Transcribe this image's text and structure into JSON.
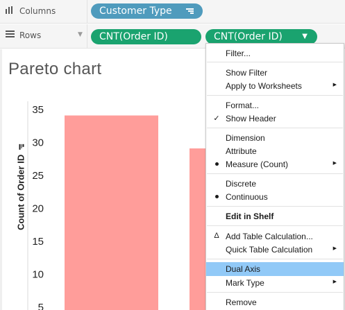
{
  "shelves": {
    "columns": {
      "label": "Columns",
      "icon": "columns-bars-icon",
      "pills": [
        "Customer Type"
      ]
    },
    "rows": {
      "label": "Rows",
      "icon": "rows-lines-icon",
      "pills": [
        "CNT(Order ID)",
        "CNT(Order ID)"
      ]
    }
  },
  "sheet": {
    "title": "Pareto chart"
  },
  "chart_data": {
    "type": "bar",
    "ylabel": "Count of Order ID",
    "ylim": [
      5,
      35
    ],
    "yticks": [
      35,
      30,
      25,
      20,
      15,
      10,
      5
    ],
    "values": [
      34,
      29
    ],
    "bar_color": "#ff9d9a"
  },
  "menu": {
    "items": {
      "filter": "Filter...",
      "show_filter": "Show Filter",
      "apply_worksheets": "Apply to Worksheets",
      "format": "Format...",
      "show_header": "Show Header",
      "dimension": "Dimension",
      "attribute": "Attribute",
      "measure_count": "Measure (Count)",
      "discrete": "Discrete",
      "continuous": "Continuous",
      "edit_in_shelf": "Edit in Shelf",
      "add_table_calc": "Add Table Calculation...",
      "quick_table_calc": "Quick Table Calculation",
      "dual_axis": "Dual Axis",
      "mark_type": "Mark Type",
      "remove": "Remove"
    },
    "marks": {
      "show_header_check": "✓",
      "delta": "Δ"
    },
    "highlight_color": "#91c9f7"
  },
  "colors": {
    "dimension_pill": "#4f9bbd",
    "measure_pill": "#1aa36f"
  }
}
